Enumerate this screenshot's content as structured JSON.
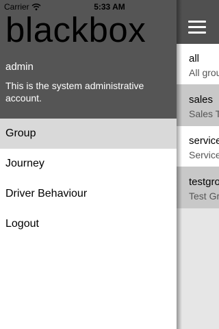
{
  "status_bar": {
    "carrier": "Carrier",
    "wifi_icon": "wifi-icon",
    "time": "5:33 AM"
  },
  "drawer": {
    "brand": "blackbox",
    "account_name": "admin",
    "account_description": "This is the system administrative account.",
    "menu": [
      {
        "label": "Group",
        "selected": true
      },
      {
        "label": "Journey",
        "selected": false
      },
      {
        "label": "Driver Behaviour",
        "selected": false
      },
      {
        "label": "Logout",
        "selected": false
      }
    ]
  },
  "main": {
    "menu_icon": "hamburger-icon",
    "groups": [
      {
        "name": "all",
        "description": "All grou"
      },
      {
        "name": "sales",
        "description": "Sales T"
      },
      {
        "name": "service",
        "description": "Service"
      },
      {
        "name": "testgro",
        "description": "Test Gr"
      }
    ]
  },
  "colors": {
    "drawer_header": "#555555",
    "navbar": "#505050",
    "selected_menu": "#d9d9d9",
    "list_background": "#e6e6e6",
    "row_alt": "#c8c8c8"
  }
}
